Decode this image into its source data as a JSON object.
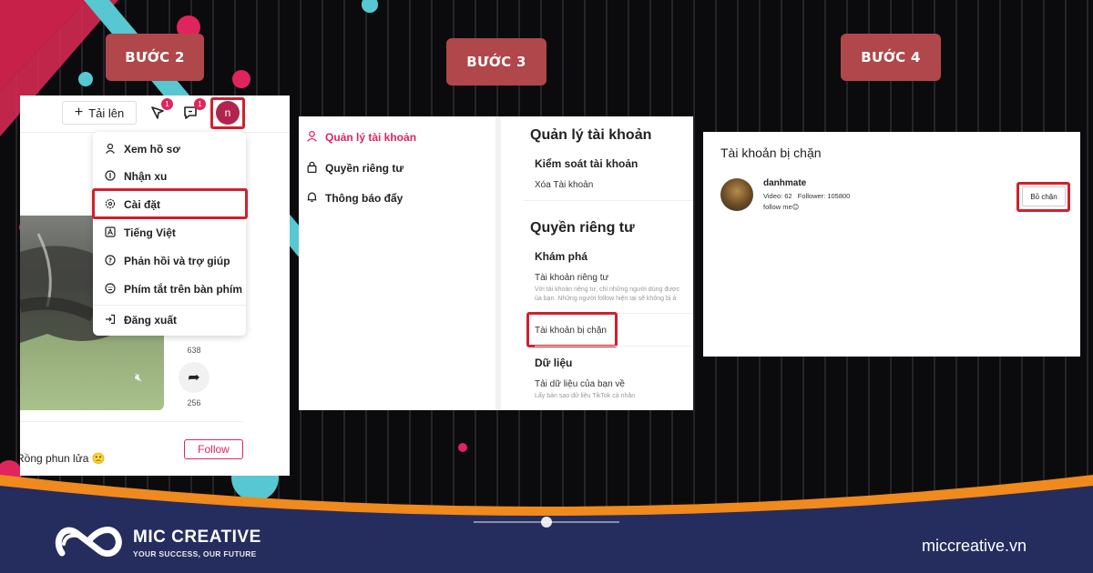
{
  "steps": {
    "step2_label": "BƯỚC 2",
    "step3_label": "BƯỚC 3",
    "step4_label": "BƯỚC 4"
  },
  "tiktok_header": {
    "upload_label": "Tải lên",
    "inbox_badge": "1",
    "messages_badge": "1",
    "avatar_letter": "n"
  },
  "profile_menu": {
    "items": [
      {
        "label": "Xem hồ sơ",
        "icon": "user-icon"
      },
      {
        "label": "Nhận xu",
        "icon": "coin-icon"
      },
      {
        "label": "Cài đặt",
        "icon": "gear-icon"
      },
      {
        "label": "Tiếng Việt",
        "icon": "language-icon"
      },
      {
        "label": "Phản hồi và trợ giúp",
        "icon": "help-icon"
      },
      {
        "label": "Phím tắt trên bàn phím",
        "icon": "keyboard-icon"
      },
      {
        "label": "Đăng xuất",
        "icon": "logout-icon"
      }
    ],
    "highlighted": "Cài đặt"
  },
  "video": {
    "comment_count": "638",
    "share_count": "256",
    "follow_label": "Follow",
    "caption": "Rồng phun lửa 🙁"
  },
  "settings": {
    "nav": [
      {
        "label": "Quản lý tài khoản",
        "icon": "user-icon",
        "active": true
      },
      {
        "label": "Quyền riêng tư",
        "icon": "lock-icon",
        "active": false
      },
      {
        "label": "Thông báo đẩy",
        "icon": "bell-icon",
        "active": false
      }
    ],
    "account_heading": "Quản lý tài khoản",
    "account_control": "Kiểm soát tài khoản",
    "delete_account": "Xóa Tài khoản",
    "privacy_heading": "Quyền riêng tư",
    "discover": "Khám phá",
    "private_account": "Tài khoản riêng tư",
    "private_desc_1": "Với tài khoản riêng tư, chỉ những người dùng được",
    "private_desc_2": "ủa bạn. Những người follow hiện tại sẽ không bị ả",
    "blocked_accounts": "Tài khoản bị chặn",
    "data_heading": "Dữ liệu",
    "download_data": "Tải dữ liệu của bạn về",
    "download_desc": "Lấy bản sao dữ liệu TikTok cả nhân"
  },
  "blocked": {
    "title": "Tài khoản bị chặn",
    "username": "danhmate",
    "stats": "Video: 62   Follower: 105800",
    "bio": "follow me😊",
    "unblock_label": "Bỏ chặn"
  },
  "brand": {
    "name": "MIC CREATIVE",
    "slogan": "YOUR SUCCESS, OUR FUTURE",
    "website": "miccreative.vn"
  },
  "colors": {
    "accent_red": "#d0202e",
    "badge_bg": "#b0474a",
    "tiktok_pink": "#e0245e",
    "footer_navy": "#252d5e",
    "footer_orange": "#f08a1c"
  }
}
